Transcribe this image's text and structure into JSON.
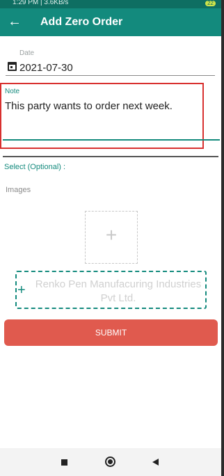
{
  "status_bar": {
    "left": "1:29 PM | 3.6KB/s",
    "battery": "22"
  },
  "app_bar": {
    "back_icon": "arrow-left-icon",
    "title": "Add Zero Order"
  },
  "form": {
    "date": {
      "label": "Date",
      "icon": "calendar-icon",
      "value": "2021-07-30"
    },
    "note": {
      "label": "Note",
      "value": "This party wants to order next week."
    },
    "select_label": "Select (Optional) :",
    "images_label": "Images",
    "image_add_icon": "plus-icon",
    "party": {
      "icon": "plus-icon",
      "name": "Renko Pen Manufacuring Industries Pvt Ltd."
    },
    "submit_label": "SUBMIT"
  },
  "nav_bar": {
    "recents_icon": "square-icon",
    "home_icon": "circle-icon",
    "back_icon": "triangle-back-icon"
  },
  "colors": {
    "app_bar": "#138a7d",
    "accent": "#138a7d",
    "submit": "#e05a4e",
    "highlight": "#d8302f"
  }
}
